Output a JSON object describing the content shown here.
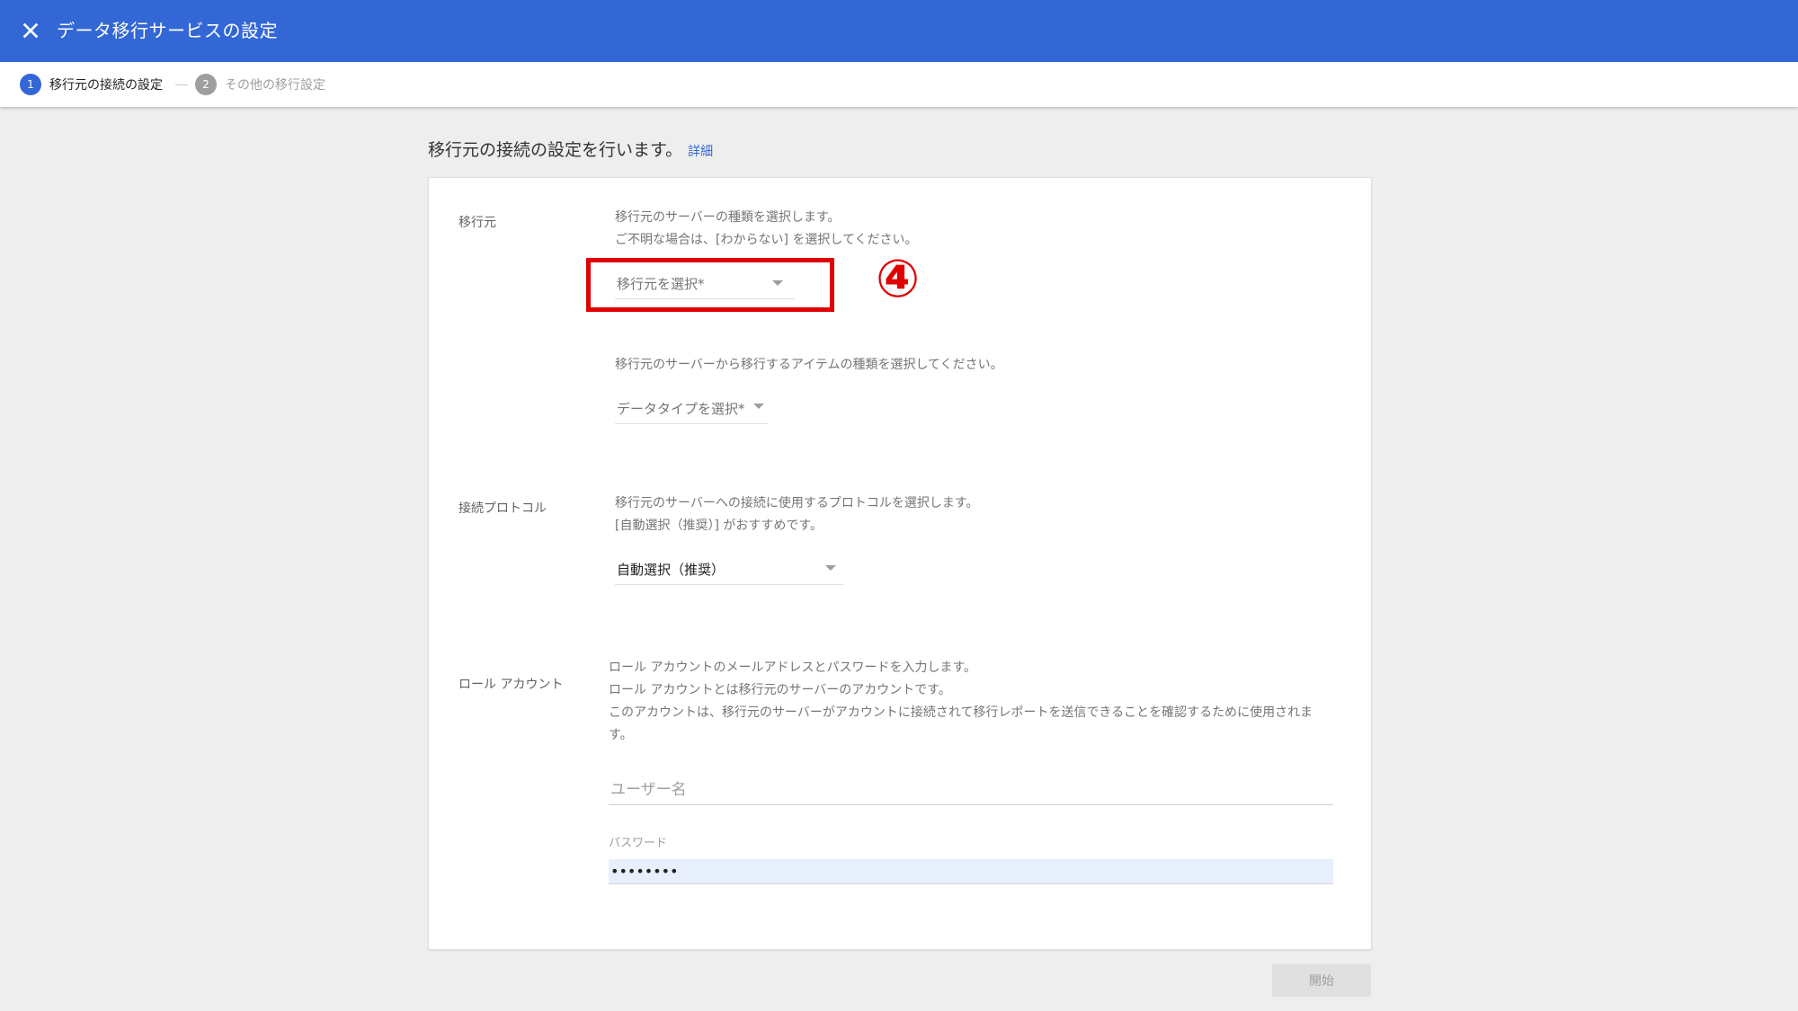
{
  "header": {
    "close_icon": "close-icon",
    "title": "データ移行サービスの設定",
    "color": "#3367d6"
  },
  "stepper": {
    "steps": [
      {
        "number": "1",
        "label": "移行元の接続の設定",
        "active": true
      },
      {
        "number": "2",
        "label": "その他の移行設定",
        "active": false
      }
    ]
  },
  "intro": {
    "text": "移行元の接続の設定を行います。",
    "link": "詳細"
  },
  "source": {
    "label": "移行元",
    "desc_1": "移行元のサーバーの種類を選択します。",
    "desc_2": "ご不明な場合は、[わからない] を選択してください。",
    "select_placeholder": "移行元を選択*",
    "annotation": "④",
    "annotation_color": "#e00000",
    "data_desc": "移行元のサーバーから移行するアイテムの種類を選択してください。",
    "data_select_placeholder": "データタイプを選択*"
  },
  "protocol": {
    "label": "接続プロトコル",
    "desc_1": "移行元のサーバーへの接続に使用するプロトコルを選択します。",
    "desc_2": "[自動選択（推奨）] がおすすめです。",
    "selected": "自動選択（推奨）"
  },
  "role_account": {
    "label": "ロール アカウント",
    "desc_1": "ロール アカウントのメールアドレスとパスワードを入力します。",
    "desc_2": "ロール アカウントとは移行元のサーバーのアカウントです。",
    "desc_3": "このアカウントは、移行元のサーバーがアカウントに接続されて移行レポートを送信できることを確認するために使用されま",
    "desc_4": "す。",
    "username_placeholder": "ユーザー名",
    "password_label": "パスワード",
    "password_value": "••••••••"
  },
  "actions": {
    "start": "開始"
  }
}
